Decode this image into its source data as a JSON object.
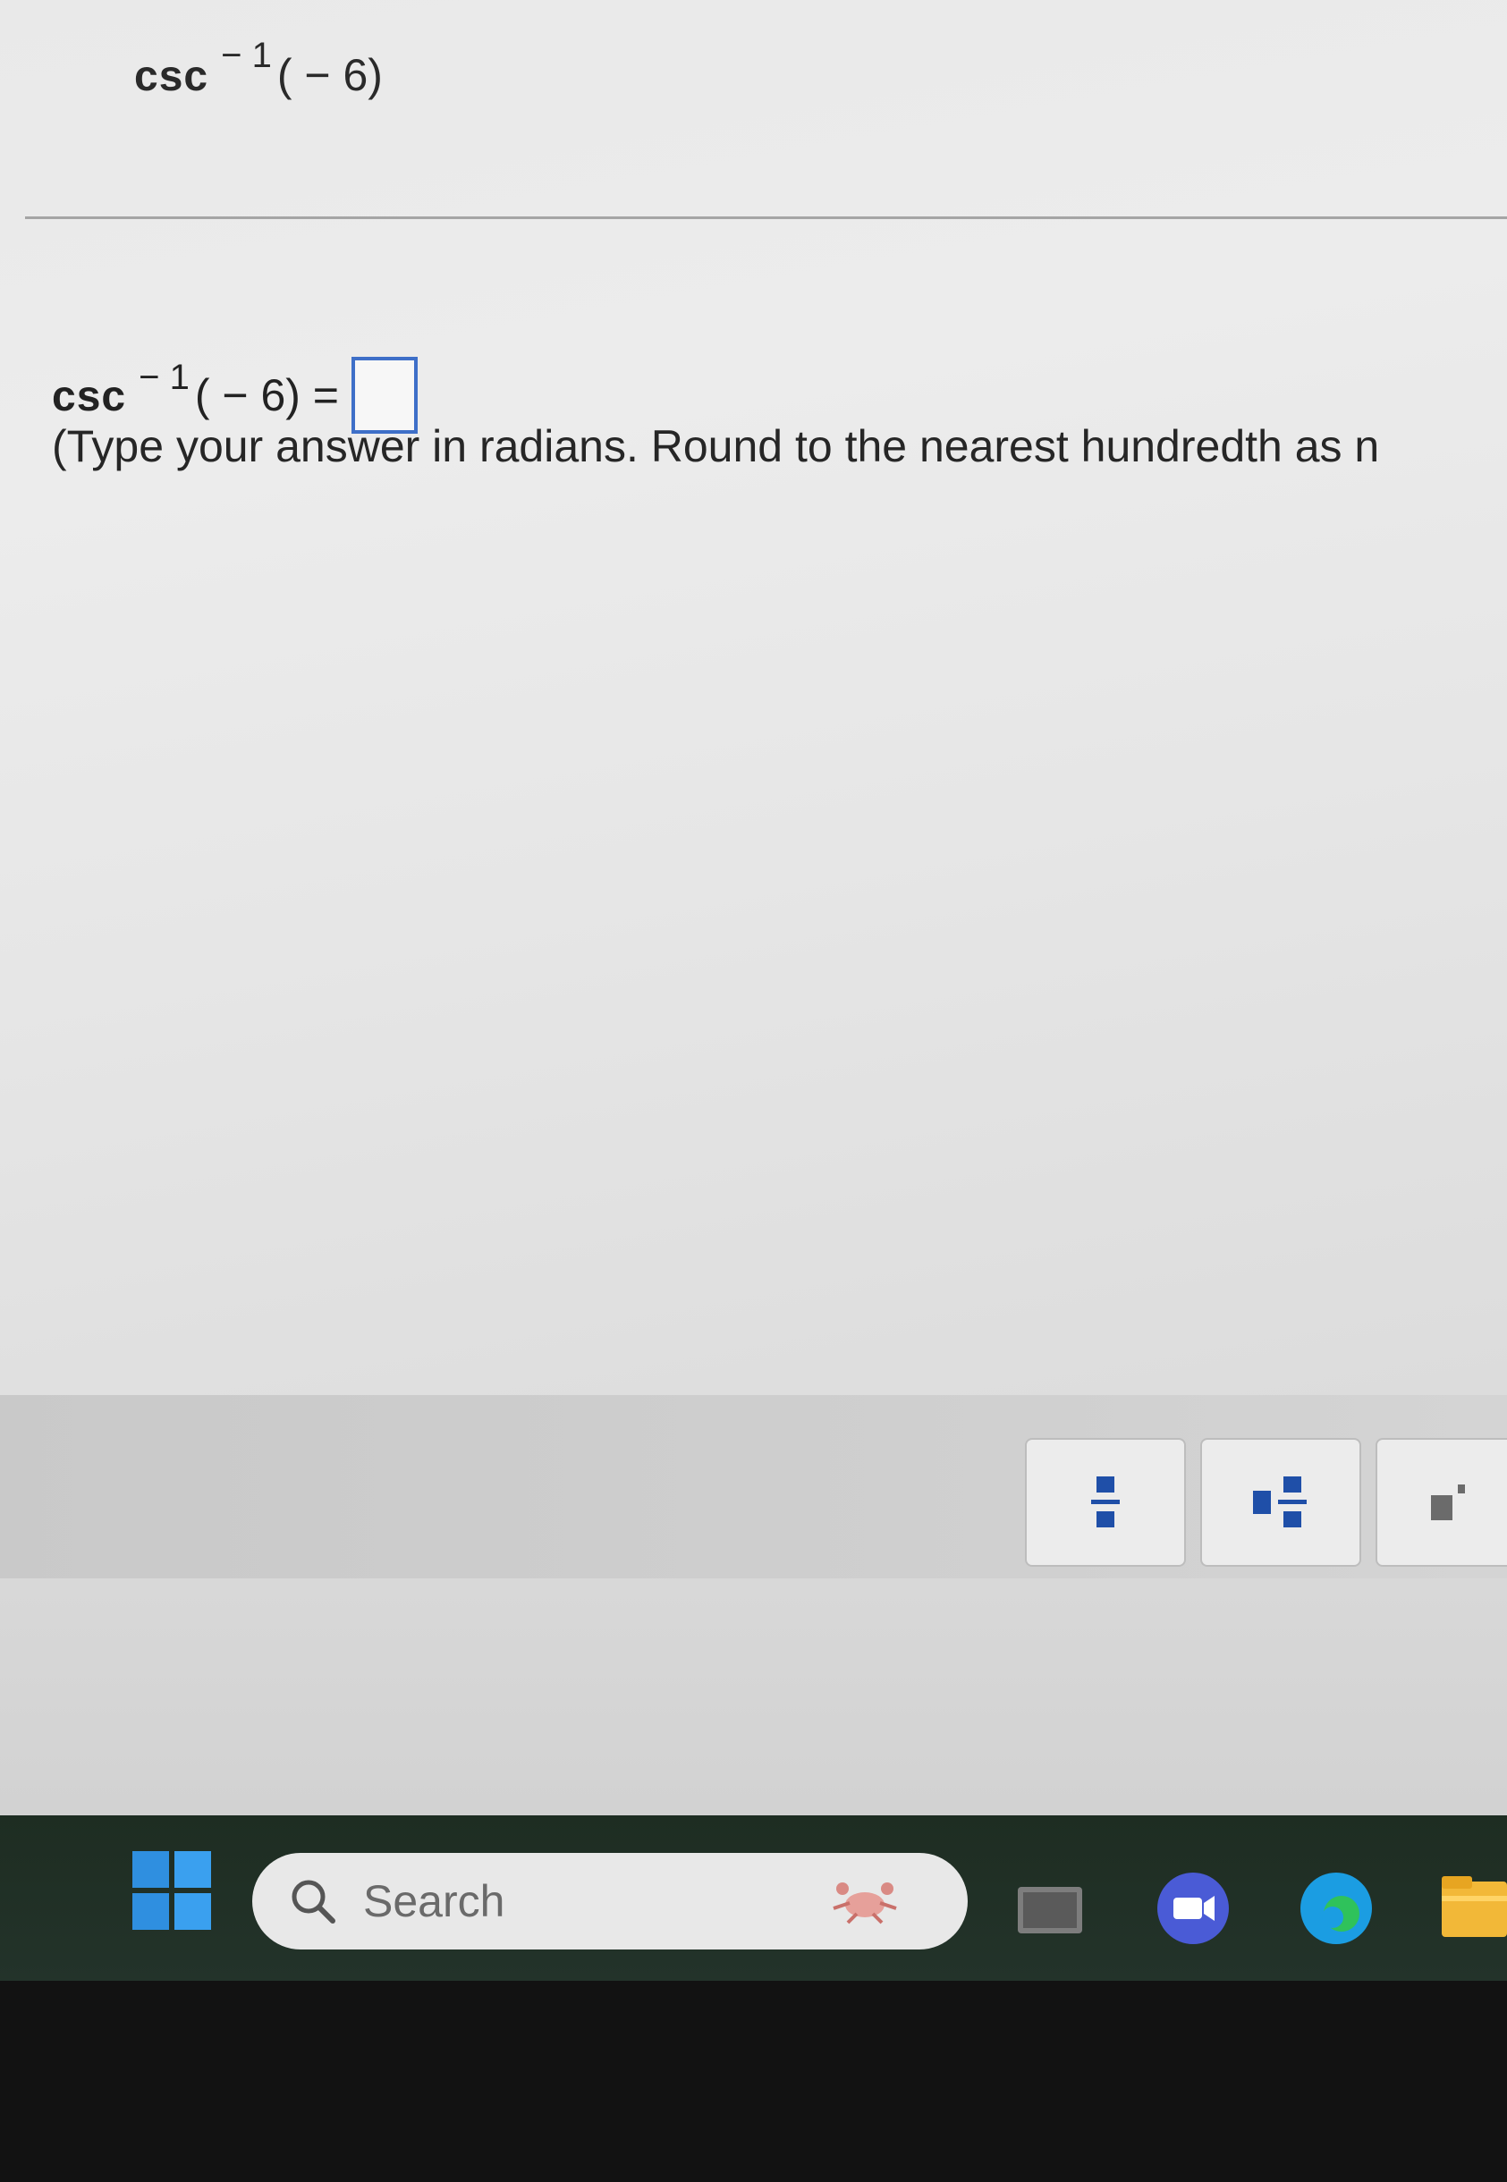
{
  "question": {
    "function": "csc",
    "exponent": "− 1",
    "argument": "( − 6)"
  },
  "answer": {
    "function": "csc",
    "exponent": "− 1",
    "argument": "( − 6) =",
    "value": ""
  },
  "instructions": "(Type your answer in radians.  Round to the nearest hundredth as n",
  "palette": {
    "buttons": [
      "fraction-icon",
      "mixed-number-icon",
      "exponent-icon"
    ]
  },
  "taskbar": {
    "search_placeholder": "Search",
    "icons": [
      "windows-start-icon",
      "file-explorer-icon",
      "video-call-icon",
      "edge-browser-icon",
      "folder-icon"
    ]
  }
}
